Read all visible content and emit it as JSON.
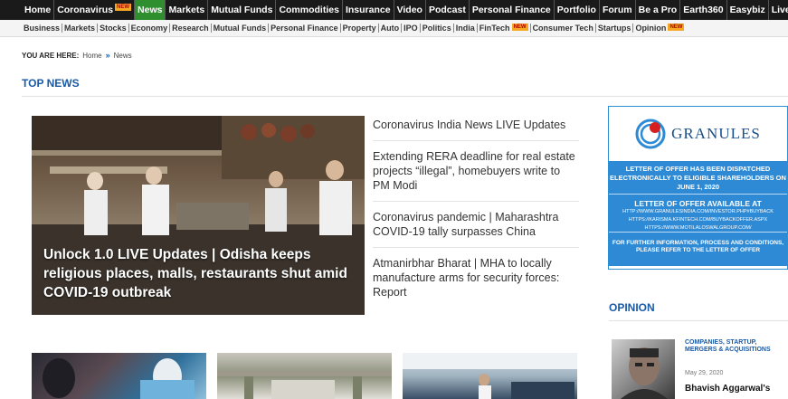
{
  "topnav": {
    "items": [
      {
        "label": "Home",
        "new": false,
        "active": false
      },
      {
        "label": "Coronavirus",
        "new": true,
        "active": false
      },
      {
        "label": "News",
        "new": false,
        "active": true
      },
      {
        "label": "Markets",
        "new": false,
        "active": false
      },
      {
        "label": "Mutual Funds",
        "new": false,
        "active": false
      },
      {
        "label": "Commodities",
        "new": false,
        "active": false
      },
      {
        "label": "Insurance",
        "new": false,
        "active": false
      },
      {
        "label": "Video",
        "new": false,
        "active": false
      },
      {
        "label": "Podcast",
        "new": false,
        "active": false
      },
      {
        "label": "Personal Finance",
        "new": false,
        "active": false
      },
      {
        "label": "Portfolio",
        "new": false,
        "active": false
      },
      {
        "label": "Forum",
        "new": false,
        "active": false
      },
      {
        "label": "Be a Pro",
        "new": false,
        "active": false
      },
      {
        "label": "Earth360",
        "new": false,
        "active": false
      },
      {
        "label": "Easybiz",
        "new": false,
        "active": false
      },
      {
        "label": "Live TV",
        "new": false,
        "active": false
      }
    ],
    "new_badge": "NEW"
  },
  "subnav": {
    "items": [
      {
        "label": "Business",
        "new": false
      },
      {
        "label": "Markets",
        "new": false
      },
      {
        "label": "Stocks",
        "new": false
      },
      {
        "label": "Economy",
        "new": false
      },
      {
        "label": "Research",
        "new": false
      },
      {
        "label": "Mutual Funds",
        "new": false
      },
      {
        "label": "Personal Finance",
        "new": false
      },
      {
        "label": "Property",
        "new": false
      },
      {
        "label": "Auto",
        "new": false
      },
      {
        "label": "IPO",
        "new": false
      },
      {
        "label": "Politics",
        "new": false
      },
      {
        "label": "India",
        "new": false
      },
      {
        "label": "FinTech",
        "new": true
      },
      {
        "label": "Consumer Tech",
        "new": false
      },
      {
        "label": "Startups",
        "new": false
      },
      {
        "label": "Opinion",
        "new": true
      }
    ]
  },
  "breadcrumb": {
    "label": "YOU ARE HERE:",
    "home": "Home",
    "separator": "»",
    "current": "News"
  },
  "top_news": {
    "title": "TOP NEWS",
    "hero_caption": "Unlock 1.0 LIVE Updates | Odisha keeps religious places, malls, restaurants shut amid COVID-19 outbreak",
    "headlines": [
      "Coronavirus India News LIVE Updates",
      "Extending RERA deadline for real estate projects “illegal”, homebuyers write to PM Modi",
      "Coronavirus pandemic | Maharashtra COVID-19 tally surpasses China",
      "Atmanirbhar Bharat | MHA to locally manufacture arms for security forces: Report"
    ]
  },
  "ad": {
    "brand": "GRANULES",
    "line1": "LETTER OF OFFER HAS BEEN DISPATCHED ELECTRONICALLY TO ELIGIBLE SHAREHOLDERS ON JUNE 1, 2020",
    "line2_title": "LETTER OF OFFER AVAILABLE AT",
    "line2_urls": [
      "HTTP://WWW.GRANULESINDIA.COM/INVESTOR.PHP#BUYBACK",
      "HTTPS://KARISMA.KFINTECH.COM/BUYBACKOFFER.ASPX",
      "HTTPS://WWW.MOTILALOSWALGROUP.COM/"
    ],
    "line3": "FOR FURTHER INFORMATION, PROCESS AND CONDITIONS, PLEASE REFER TO THE LETTER OF OFFER"
  },
  "opinion": {
    "title": "OPINION",
    "category": "COMPANIES, STARTUP, MERGERS & ACQUISITIONS",
    "date": "May 29, 2020",
    "author": "Bhavish Aggarwal's"
  },
  "colors": {
    "nav_bg": "#1a1a1a",
    "active_tab": "#2f8f2f",
    "section_blue": "#1a5aa6",
    "ad_blue": "#2e8ad5",
    "new_badge": "#f5a623"
  }
}
